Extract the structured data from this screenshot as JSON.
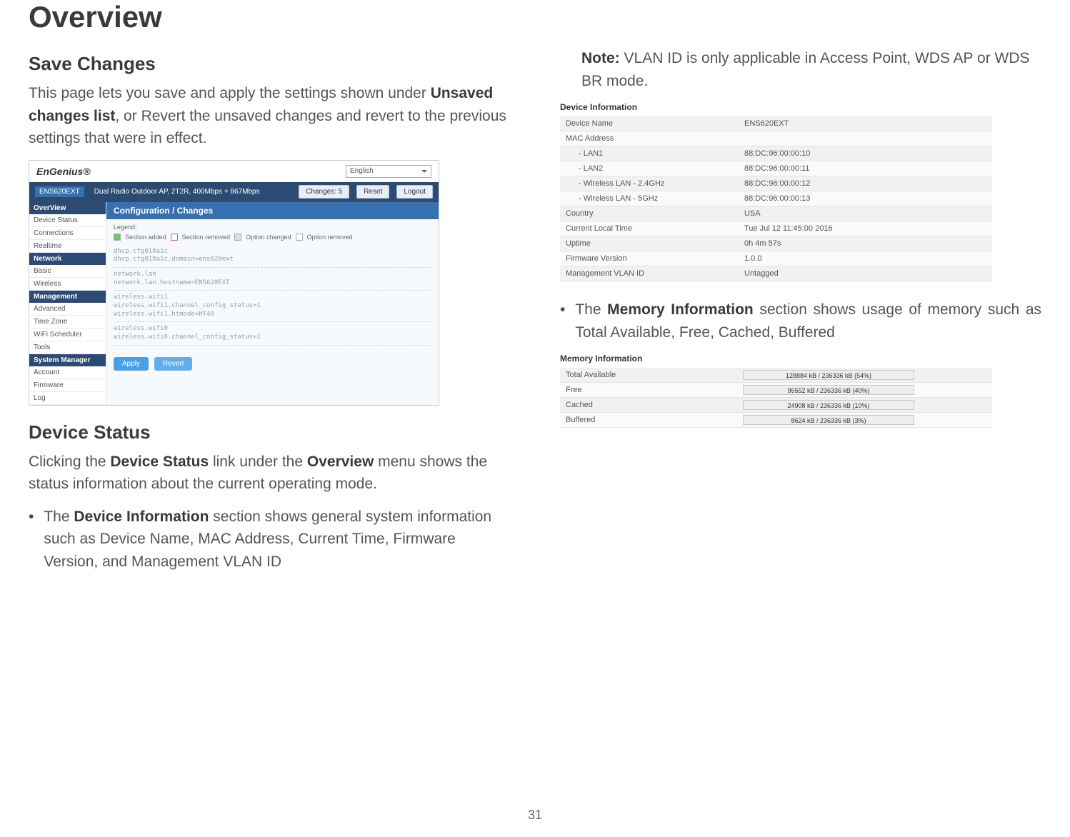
{
  "page": {
    "title": "Overview",
    "number": "31"
  },
  "saveChanges": {
    "heading": "Save Changes",
    "para_pre": "This page lets you save and apply the settings shown under ",
    "para_strong": "Unsaved changes list",
    "para_post": ", or Revert the unsaved changes and revert to the previous settings that were in effect."
  },
  "deviceStatus": {
    "heading": "Device Status",
    "intro_pre": "Clicking the ",
    "intro_s1": "Device Status",
    "intro_mid": " link under the ",
    "intro_s2": "Overview",
    "intro_post": " menu shows the status information about the current operating mode.",
    "bullet_pre": "The ",
    "bullet_strong": "Device Information",
    "bullet_post": " section shows general system information such as Device Name, MAC Address, Current Time, Firmware Version, and Management VLAN ID"
  },
  "rightCol": {
    "note_label": "Note:",
    "note_text": " VLAN ID is only applicable in Access Point, WDS AP or WDS BR mode.",
    "mem_pre": "The ",
    "mem_strong": "Memory Information",
    "mem_post": " section shows usage of memory such as Total Available, Free, Cached, Buffered"
  },
  "shot1": {
    "logo": "EnGenius®",
    "lang": "English",
    "model": "ENS620EXT",
    "desc": "Dual Radio Outdoor AP, 2T2R, 400Mbps + 867Mbps",
    "btn_changes": "Changes: 5",
    "btn_reset": "Reset",
    "btn_logout": "Logout",
    "cfg_title": "Configuration / Changes",
    "legend_label": "Legend:",
    "legend_added": "Section added",
    "legend_removed": "Section removed",
    "legend_optchg": "Option changed",
    "legend_optrem": "Option removed",
    "opt1": "dhcp.cfg018a1c",
    "opt2": "dhcp.cfg018a1c.domain=ens620ext",
    "opt3": "network.lan",
    "opt4": "network.lan.hostname=ENS620EXT",
    "opt5": "wireless.wifi1",
    "opt6": "wireless.wifi1.channel_config_status=1",
    "opt7": "wireless.wifi1.htmode=HT40",
    "opt8": "wireless.wifi0",
    "opt9": "wireless.wifi0.channel_config_status=1",
    "apply": "Apply",
    "revert": "Revert",
    "side": {
      "h1": "OverView",
      "i1": "Device Status",
      "i2": "Connections",
      "i3": "Realtime",
      "h2": "Network",
      "i4": "Basic",
      "i5": "Wireless",
      "h3": "Management",
      "i6": "Advanced",
      "i7": "Time Zone",
      "i8": "WiFi Scheduler",
      "i9": "Tools",
      "h4": "System Manager",
      "i10": "Account",
      "i11": "Firmware",
      "i12": "Log"
    }
  },
  "shot2": {
    "title": "Device Information",
    "r1l": "Device Name",
    "r1v": "ENS620EXT",
    "r2l": "MAC Address",
    "r2v": "",
    "r3l": "- LAN1",
    "r3v": "88:DC:96:00:00:10",
    "r4l": "- LAN2",
    "r4v": "88:DC:96:00:00:11",
    "r5l": "- Wireless LAN - 2.4GHz",
    "r5v": "88:DC:96:00:00:12",
    "r6l": "- Wireless LAN - 5GHz",
    "r6v": "88:DC:96:00:00:13",
    "r7l": "Country",
    "r7v": "USA",
    "r8l": "Current Local Time",
    "r8v": "Tue Jul 12 11:45:00 2016",
    "r9l": "Uptime",
    "r9v": "0h 4m 57s",
    "r10l": "Firmware Version",
    "r10v": "1.0.0",
    "r11l": "Management VLAN ID",
    "r11v": "Untagged"
  },
  "shot3": {
    "title": "Memory Information",
    "r1l": "Total Available",
    "r1v": "128884 kB / 236336 kB (54%)",
    "r2l": "Free",
    "r2v": "95552 kB / 236336 kB (40%)",
    "r3l": "Cached",
    "r3v": "24908 kB / 236336 kB (10%)",
    "r4l": "Buffered",
    "r4v": "8624 kB / 236336 kB (3%)"
  }
}
